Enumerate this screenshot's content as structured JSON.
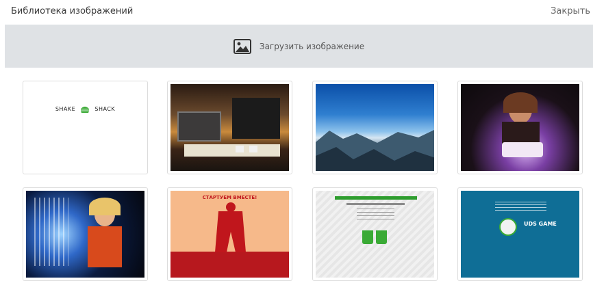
{
  "header": {
    "title": "Библиотека изображений",
    "close_label": "Закрыть"
  },
  "upload": {
    "label": "Загрузить изображение",
    "icon": "image-icon"
  },
  "gallery": {
    "items": [
      {
        "kind": "logo",
        "logo_left": "SHAKE",
        "logo_right": "SHACK"
      },
      {
        "kind": "photo",
        "subject": "restaurant interior with counter"
      },
      {
        "kind": "photo",
        "subject": "mountain landscape with blue sky"
      },
      {
        "kind": "photo",
        "subject": "woman with birthday cake and sparklers"
      },
      {
        "kind": "photo",
        "subject": "woman with sparkler cake at party"
      },
      {
        "kind": "poster",
        "headline": "СТАРТУЕМ ВМЕСТЕ!"
      },
      {
        "kind": "poster",
        "subject": "promo flyer with two green cups"
      },
      {
        "kind": "poster",
        "brand": "UDS GAME"
      }
    ]
  },
  "colors": {
    "upload_bg": "#dfe2e5",
    "tile_border": "#dcdcdc",
    "accent_green": "#3aaa35",
    "poster_orange": "#f6b98a",
    "poster_red": "#b7181e",
    "uds_blue": "#0f6e96"
  }
}
